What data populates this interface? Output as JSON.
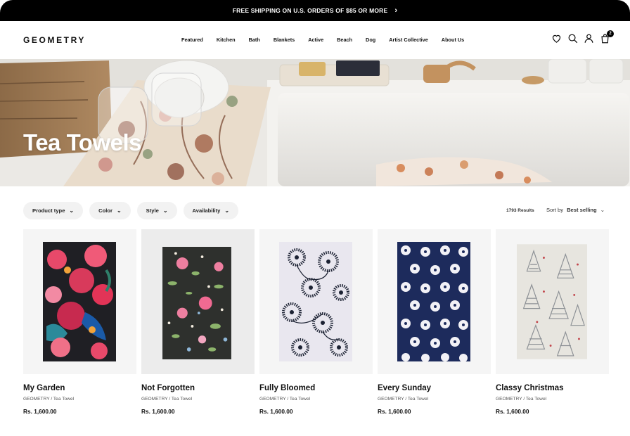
{
  "announcement": {
    "text": "FREE SHIPPING ON U.S. ORDERS OF $85 OR MORE",
    "arrow_icon": "chevron-right-icon"
  },
  "header": {
    "logo": "GEOMETRY",
    "nav": [
      "Featured",
      "Kitchen",
      "Bath",
      "Blankets",
      "Active",
      "Beach",
      "Dog",
      "Artist Collective",
      "About Us"
    ],
    "cart_count": "2",
    "icons": [
      "heart-icon",
      "search-icon",
      "account-icon",
      "cart-icon"
    ]
  },
  "hero": {
    "title": "Tea Towels"
  },
  "filters": [
    "Product type",
    "Color",
    "Style",
    "Availability"
  ],
  "results_count": "1793 Results",
  "sort": {
    "label": "Sort by",
    "value": "Best selling"
  },
  "products": [
    {
      "name": "My Garden",
      "meta": "GEOMETRY / Tea Towel",
      "price": "Rs. 1,600.00"
    },
    {
      "name": "Not Forgotten",
      "meta": "GEOMETRY / Tea Towel",
      "price": "Rs. 1,600.00"
    },
    {
      "name": "Fully Bloomed",
      "meta": "GEOMETRY / Tea Towel",
      "price": "Rs. 1,600.00"
    },
    {
      "name": "Every Sunday",
      "meta": "GEOMETRY / Tea Towel",
      "price": "Rs. 1,600.00"
    },
    {
      "name": "Classy Christmas",
      "meta": "GEOMETRY / Tea Towel",
      "price": "Rs. 1,600.00"
    }
  ]
}
